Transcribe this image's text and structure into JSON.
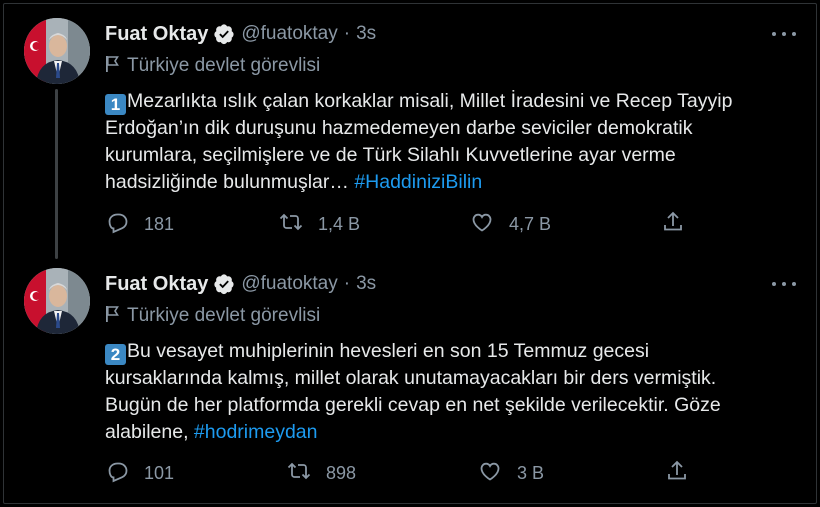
{
  "tweets": [
    {
      "author": "Fuat Oktay",
      "handle": "@fuatoktay",
      "separator": "·",
      "time": "3s",
      "label": "Türkiye devlet görevlisi",
      "keycap": "1",
      "text_lines": [
        "Mezarlıkta ıslık çalan korkaklar misali, Millet İradesini ve Recep Tayyip",
        "Erdoğan’ın dik duruşunu hazmedemeyen darbe seviciler demokratik",
        "kurumlara, seçilmişlere ve de Türk Silahlı Kuvvetlerine ayar verme",
        "hadsizliğinde bulunmuşlar… "
      ],
      "hashtag": "#HaddiniziBilin",
      "replies": "181",
      "retweets": "1,4 B",
      "likes": "4,7 B"
    },
    {
      "author": "Fuat Oktay",
      "handle": "@fuatoktay",
      "separator": "·",
      "time": "3s",
      "label": "Türkiye devlet görevlisi",
      "keycap": "2",
      "text_lines": [
        "Bu vesayet muhiplerinin hevesleri en son 15 Temmuz gecesi",
        "kursaklarında kalmış, millet olarak unutamayacakları bir ders vermiştik.",
        "Bugün de her platformda gerekli cevap en net şekilde verilecektir. Göze",
        "alabilene, "
      ],
      "hashtag": "#hodrimeydan",
      "replies": "101",
      "retweets": "898",
      "likes": "3 B"
    }
  ],
  "colors": {
    "background": "#000000",
    "text": "#e7e9ea",
    "muted": "#8b98a5",
    "link": "#1d9bf0",
    "verified": "#e7e9ea",
    "keycap": "#3b88c3"
  },
  "icons": [
    "verified-badge-icon",
    "flag-icon",
    "more-icon",
    "reply-icon",
    "retweet-icon",
    "like-icon",
    "share-icon"
  ]
}
